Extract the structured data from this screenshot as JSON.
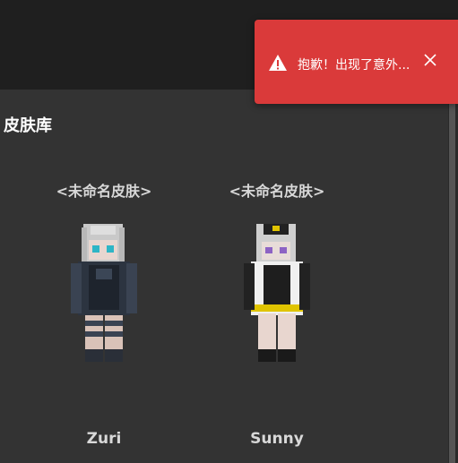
{
  "library": {
    "title": "皮肤库",
    "skins": [
      {
        "name": "<未命名皮肤>",
        "owner": "Zuri"
      },
      {
        "name": "<未命名皮肤>",
        "owner": "Sunny"
      }
    ]
  },
  "toast": {
    "message": "抱歉！出现了意外...",
    "icon": "warning-icon",
    "close_icon": "close-icon",
    "color": "#da3a3a"
  }
}
